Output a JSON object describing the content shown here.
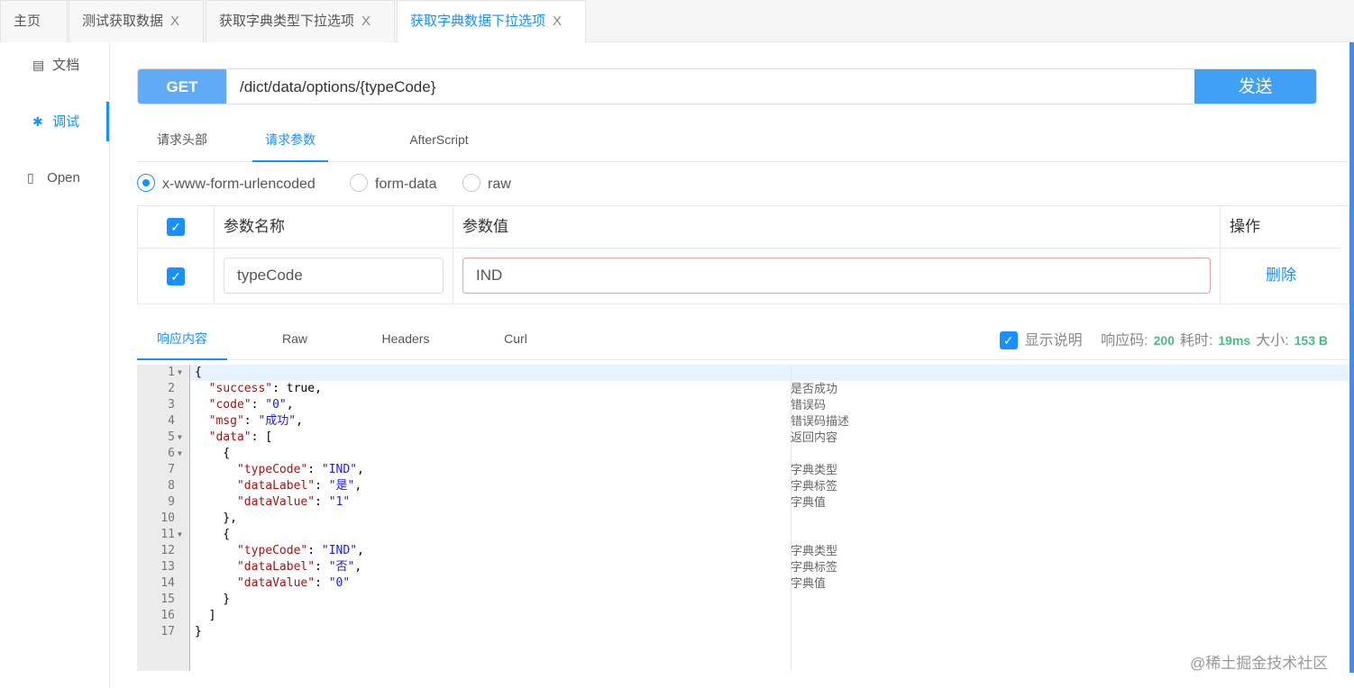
{
  "tabs": [
    {
      "label": "主页"
    },
    {
      "label": "测试获取数据",
      "close": "X"
    },
    {
      "label": "获取字典类型下拉选项",
      "close": "X"
    },
    {
      "label": "获取字典数据下拉选项",
      "close": "X",
      "active": true
    }
  ],
  "sidebar": {
    "items": [
      {
        "label": "文档",
        "icon": "document-icon"
      },
      {
        "label": "调试",
        "icon": "bug-icon",
        "active": true
      },
      {
        "label": "Open",
        "icon": "file-icon"
      }
    ]
  },
  "request": {
    "method": "GET",
    "url": "/dict/data/options/{typeCode}",
    "send_label": "发送"
  },
  "request_tabs": [
    "请求头部",
    "请求参数",
    "AfterScript"
  ],
  "body_types": [
    {
      "label": "x-www-form-urlencoded",
      "selected": true
    },
    {
      "label": "form-data"
    },
    {
      "label": "raw"
    }
  ],
  "params": {
    "headers": {
      "name": "参数名称",
      "value": "参数值",
      "op": "操作"
    },
    "rows": [
      {
        "checked": true,
        "name": "typeCode",
        "value": "IND",
        "action": "删除"
      }
    ]
  },
  "response_tabs": [
    "响应内容",
    "Raw",
    "Headers",
    "Curl"
  ],
  "response_meta": {
    "show_desc": "显示说明",
    "code_label": "响应码:",
    "code": "200",
    "time_label": "耗时:",
    "time": "19ms",
    "size_label": "大小:",
    "size": "153 B"
  },
  "response_lines": [
    {
      "n": "1",
      "fold": true,
      "code": "{",
      "c": ""
    },
    {
      "n": "2",
      "code": "  \"success\": true,",
      "c": "是否成功"
    },
    {
      "n": "3",
      "code": "  \"code\": \"0\",",
      "c": "错误码"
    },
    {
      "n": "4",
      "code": "  \"msg\": \"成功\",",
      "c": "错误码描述"
    },
    {
      "n": "5",
      "fold": true,
      "code": "  \"data\": [",
      "c": "返回内容"
    },
    {
      "n": "6",
      "fold": true,
      "code": "    {",
      "c": ""
    },
    {
      "n": "7",
      "code": "      \"typeCode\": \"IND\",",
      "c": "字典类型"
    },
    {
      "n": "8",
      "code": "      \"dataLabel\": \"是\",",
      "c": "字典标签"
    },
    {
      "n": "9",
      "code": "      \"dataValue\": \"1\"",
      "c": "字典值"
    },
    {
      "n": "10",
      "code": "    },",
      "c": ""
    },
    {
      "n": "11",
      "fold": true,
      "code": "    {",
      "c": ""
    },
    {
      "n": "12",
      "code": "      \"typeCode\": \"IND\",",
      "c": "字典类型"
    },
    {
      "n": "13",
      "code": "      \"dataLabel\": \"否\",",
      "c": "字典标签"
    },
    {
      "n": "14",
      "code": "      \"dataValue\": \"0\"",
      "c": "字典值"
    },
    {
      "n": "15",
      "code": "    }",
      "c": ""
    },
    {
      "n": "16",
      "code": "  ]",
      "c": ""
    },
    {
      "n": "17",
      "code": "}",
      "c": ""
    }
  ],
  "watermark": "@稀土掘金技术社区"
}
